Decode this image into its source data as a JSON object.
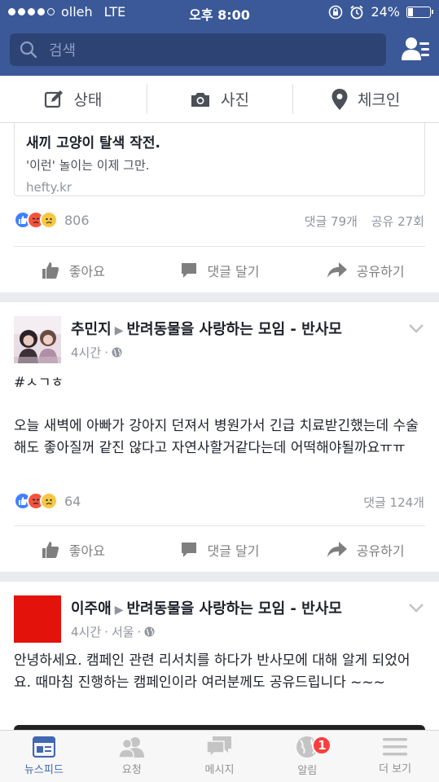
{
  "status_bar": {
    "carrier": "olleh",
    "network": "LTE",
    "time": "오후 8:00",
    "battery": "24%"
  },
  "search": {
    "placeholder": "검색"
  },
  "composer": {
    "status": "상태",
    "photo": "사진",
    "checkin": "체크인"
  },
  "post1": {
    "link_title": "새끼 고양이 탈색 작전.",
    "link_desc": "'이런' 놀이는 이제 그만.",
    "link_domain": "hefty.kr",
    "reaction_count": "806",
    "comments": "댓글 79개",
    "shares": "공유 27회"
  },
  "post2": {
    "author": "추민지",
    "group": "반려동물을 사랑하는 모임 - 반사모",
    "time": "4시간",
    "hashtag": "#ㅅㄱㅎ",
    "text": "오늘 새벽에 아빠가 강아지 던져서 병원가서 긴급 치료받긴했는데 수술해도 좋아질꺼 같진 않다고 자연사할거같다는데 어떡해야될까요ㅠㅠ",
    "reaction_count": "64",
    "comments": "댓글 124개"
  },
  "post3": {
    "author": "이주애",
    "group": "반려동물을 사랑하는 모임 - 반사모",
    "time": "4시간",
    "location": "서울",
    "text": "안녕하세요. 캠페인 관련 리서치를 하다가 반사모에 대해 알게 되었어요. 때마침 진행하는 캠페인이라 여러분께도 공유드립니다 ~~~"
  },
  "actions": {
    "like": "좋아요",
    "comment": "댓글 달기",
    "share": "공유하기"
  },
  "tabbar": {
    "newsfeed": "뉴스피드",
    "requests": "요청",
    "messages": "메시지",
    "notifications": "알림",
    "notifications_badge": "1",
    "more": "더 보기"
  },
  "colors": {
    "brand": "#3b5998",
    "active_tab": "#4267b2",
    "badge": "#fa3e3e"
  }
}
